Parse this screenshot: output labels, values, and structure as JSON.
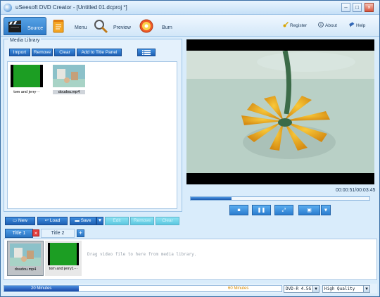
{
  "window": {
    "title": "uSeesoft DVD Creator - [Untitled 01.dcproj *]",
    "minimize": "–",
    "maximize": "□",
    "close": "×"
  },
  "toolbar": {
    "tabs": [
      {
        "label": "Source",
        "icon": "clapper-icon",
        "active": true
      },
      {
        "label": "Menu",
        "icon": "notepad-icon",
        "active": false
      },
      {
        "label": "Preview",
        "icon": "magnifier-icon",
        "active": false
      },
      {
        "label": "Burn",
        "icon": "disc-icon",
        "active": false
      }
    ],
    "links": [
      {
        "label": "Register",
        "icon": "key-icon"
      },
      {
        "label": "About",
        "icon": "info-icon"
      },
      {
        "label": "Help",
        "icon": "help-book-icon"
      }
    ]
  },
  "media_library": {
    "title": "Media Library",
    "buttons": {
      "import": "Import",
      "remove": "Remove",
      "clear": "Clear",
      "add_to_title": "Add to Title Panel"
    },
    "items": [
      {
        "caption": "tom and jerry···",
        "icon": "green-thumbnail"
      },
      {
        "caption": "doudou.mp4",
        "icon": "room-thumbnail"
      }
    ]
  },
  "project_actions": {
    "new": "New",
    "load": "Load",
    "save": "Save",
    "edit": "Edit",
    "remove": "Remove",
    "clear": "Clear"
  },
  "player": {
    "time": "00:00:51/00:03:45",
    "progress_fraction": 0.23
  },
  "titles": {
    "tabs": [
      {
        "label": "Title 1",
        "active": true
      },
      {
        "label": "Title 2",
        "active": false
      }
    ],
    "add": "+",
    "close": "×",
    "items": [
      {
        "caption": "doudou.mp4"
      },
      {
        "caption": "tom and jerry1···"
      }
    ],
    "hint": "Drag video file to here from media library."
  },
  "status": {
    "used": "20 Minutes",
    "total": "60 Minutes",
    "fill_fraction": 0.27,
    "disc_type": "DVD-R 4.5G",
    "quality": "High Quality"
  }
}
